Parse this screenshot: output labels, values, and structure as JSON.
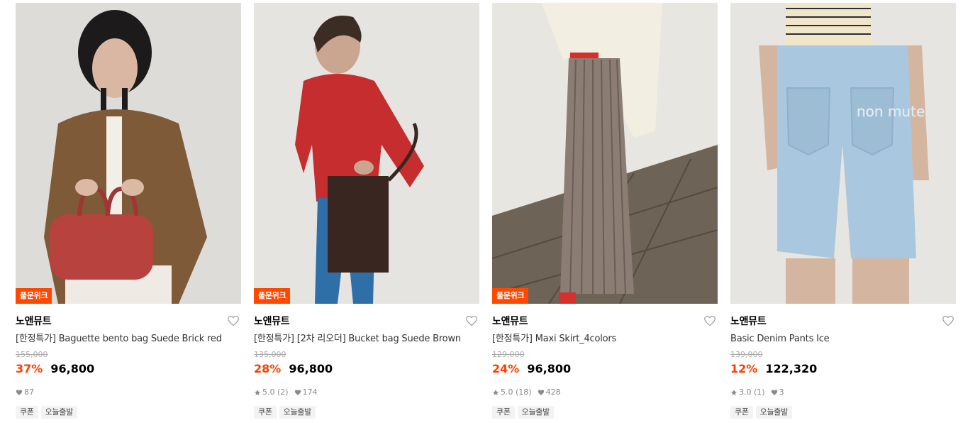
{
  "products": [
    {
      "badge": "풀문위크",
      "brand": "노앤뮤트",
      "title": "[한정특가] Baguette bento bag Suede Brick red",
      "original_price": "155,000",
      "discount": "37%",
      "price": "96,800",
      "rating": "",
      "likes": "87",
      "tags": [
        "쿠폰",
        "오늘출발"
      ]
    },
    {
      "badge": "풀문위크",
      "brand": "노앤뮤트",
      "title": "[한정특가] [2차 리오더] Bucket bag Suede Brown",
      "original_price": "135,000",
      "discount": "28%",
      "price": "96,800",
      "rating": "5.0 (2)",
      "likes": "174",
      "tags": [
        "쿠폰",
        "오늘출발"
      ]
    },
    {
      "badge": "풀문위크",
      "brand": "노앤뮤트",
      "title": "[한정특가] Maxi Skirt_4colors",
      "original_price": "129,000",
      "discount": "24%",
      "price": "96,800",
      "rating": "5.0 (18)",
      "likes": "428",
      "tags": [
        "쿠폰",
        "오늘출발"
      ]
    },
    {
      "badge": "",
      "brand": "노앤뮤트",
      "title": "Basic Denim Pants Ice",
      "original_price": "139,000",
      "discount": "12%",
      "price": "122,320",
      "rating": "3.0 (1)",
      "likes": "3",
      "tags": [
        "쿠폰",
        "오늘출발"
      ]
    }
  ],
  "image_text": {
    "denim_pocket_embroidery": "non mute"
  },
  "colors": {
    "badge_bg": "#ff4800",
    "discount": "#ff3d00"
  }
}
